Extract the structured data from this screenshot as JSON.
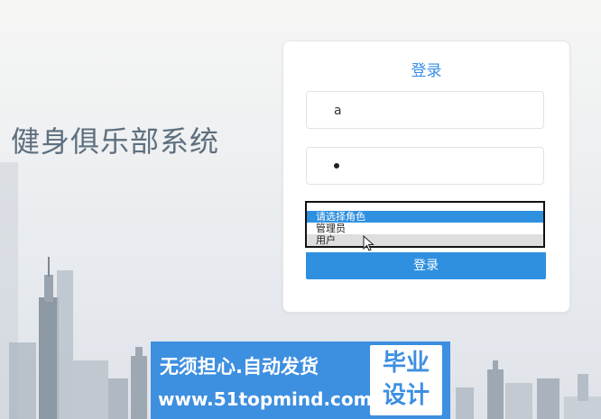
{
  "system_title": "健身俱乐部系统",
  "login": {
    "heading": "登录",
    "username_value": "a",
    "password_masked": true,
    "role_options": [
      "请选择角色",
      "管理员",
      "用户"
    ],
    "selected_role_index": 0,
    "hovered_role_index": 2,
    "submit_label": "登录"
  },
  "watermark": {
    "slogan": "无须担心.自动发货",
    "url": "www.51topmind.com",
    "badge_line1": "毕业",
    "badge_line2": "设计"
  },
  "colors": {
    "accent": "#2f90e0",
    "title_text": "#5d6f7f",
    "watermark_bg": "#3d8fe0"
  }
}
